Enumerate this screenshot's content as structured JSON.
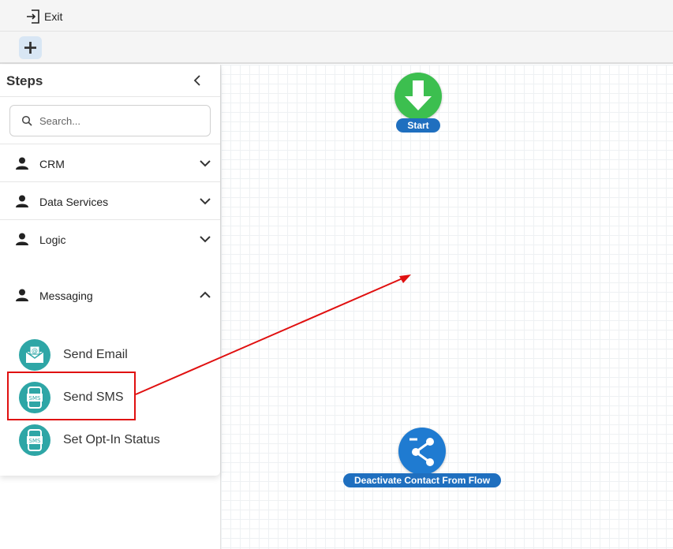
{
  "topbar": {
    "exit_label": "Exit"
  },
  "sidebar": {
    "title": "Steps",
    "search_placeholder": "Search...",
    "categories": [
      {
        "label": "CRM",
        "expanded": false
      },
      {
        "label": "Data Services",
        "expanded": false
      },
      {
        "label": "Logic",
        "expanded": false
      },
      {
        "label": "Messaging",
        "expanded": true
      }
    ],
    "messaging_steps": [
      {
        "label": "Send Email",
        "icon": "email-icon"
      },
      {
        "label": "Send SMS",
        "icon": "sms-icon"
      },
      {
        "label": "Set Opt-In Status",
        "icon": "sms-icon"
      }
    ]
  },
  "canvas": {
    "nodes": [
      {
        "label": "Start",
        "icon": "down-arrow-icon",
        "color": "#3cbf4f"
      },
      {
        "label": "Deactivate Contact From Flow",
        "icon": "share-icon",
        "color": "#1f7bd1"
      }
    ]
  },
  "colors": {
    "accent": "#1f6fbf",
    "highlight": "#e01010",
    "step_icon": "#2ea6a6"
  }
}
